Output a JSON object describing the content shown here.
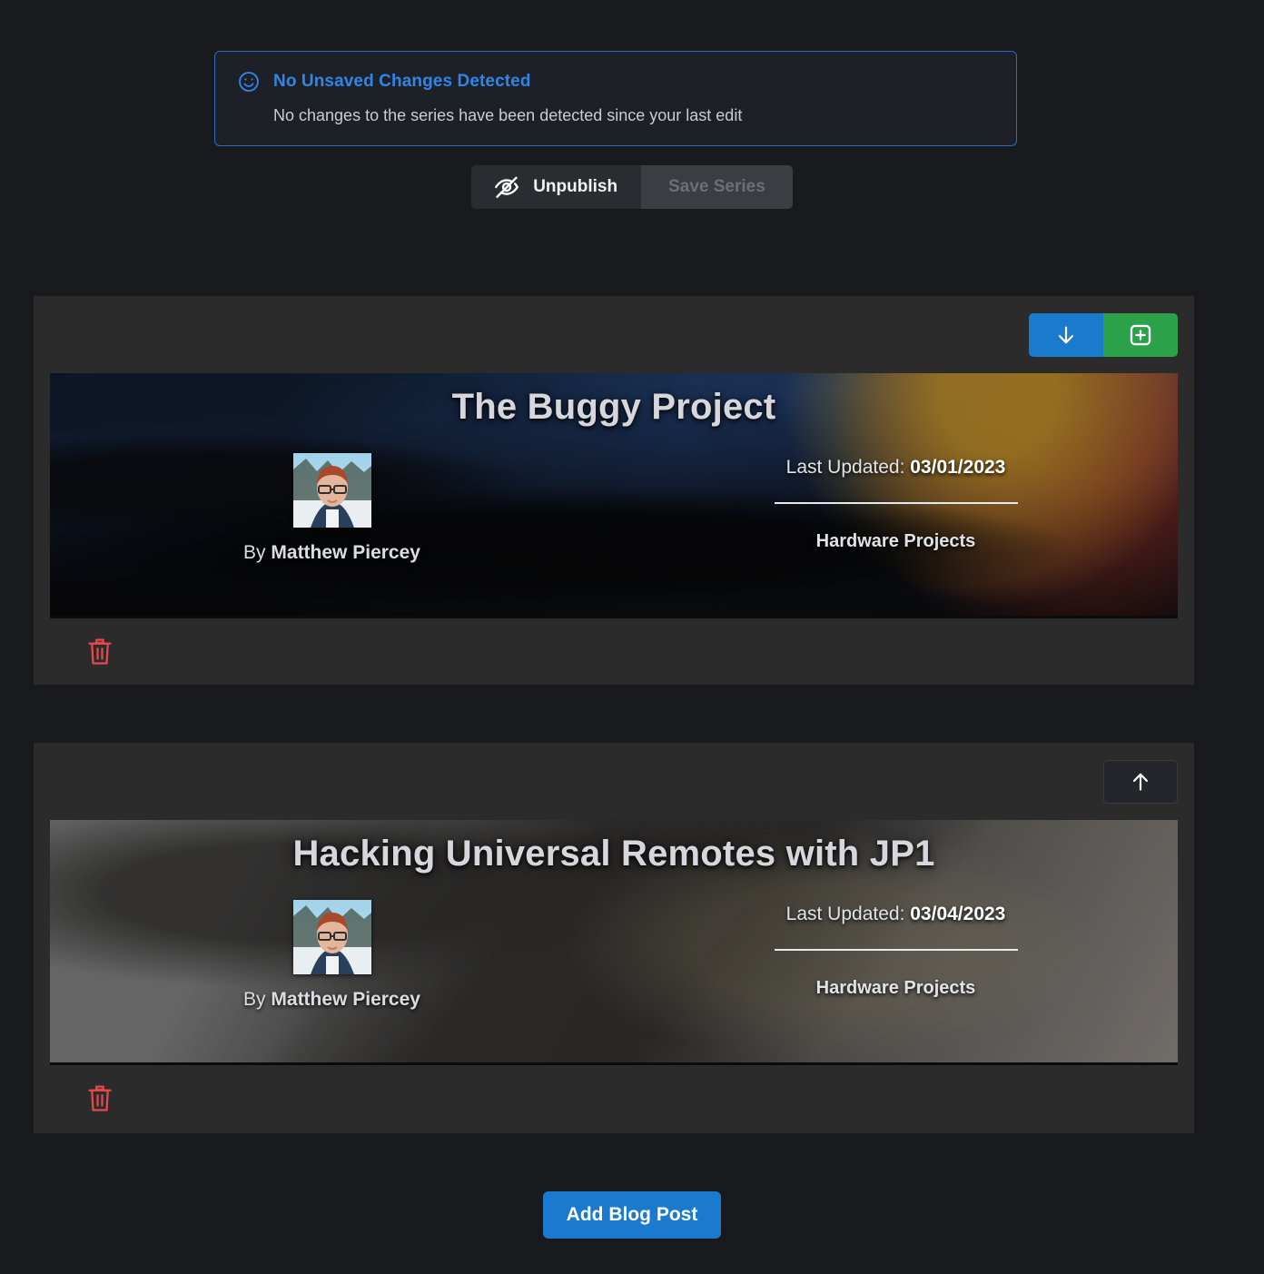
{
  "alert": {
    "icon": "smiley-face-icon",
    "title": "No Unsaved Changes Detected",
    "message": "No changes to the series have been detected since your last edit",
    "border_color": "#2a6dc0",
    "title_color": "#2f86e8"
  },
  "actions": {
    "unpublish_label": "Unpublish",
    "unpublish_icon": "eye-slash-icon",
    "save_label": "Save Series",
    "save_disabled": true
  },
  "posts": [
    {
      "title": "The Buggy Project",
      "by_prefix": "By",
      "author": "Matthew Piercey",
      "updated_label": "Last Updated:",
      "updated_date": "03/01/2023",
      "category": "Hardware Projects",
      "toolbar": {
        "move_down_icon": "arrow-down-icon",
        "add_icon": "plus-square-icon",
        "move_down_color": "#1a7bce",
        "add_color": "#2ba14a"
      },
      "delete_icon": "trash-icon"
    },
    {
      "title": "Hacking Universal Remotes with JP1",
      "by_prefix": "By",
      "author": "Matthew Piercey",
      "updated_label": "Last Updated:",
      "updated_date": "03/04/2023",
      "category": "Hardware Projects",
      "toolbar": {
        "move_up_icon": "arrow-up-icon"
      },
      "delete_icon": "trash-icon"
    }
  ],
  "footer": {
    "add_post_label": "Add Blog Post",
    "add_post_color": "#1a7bce"
  }
}
